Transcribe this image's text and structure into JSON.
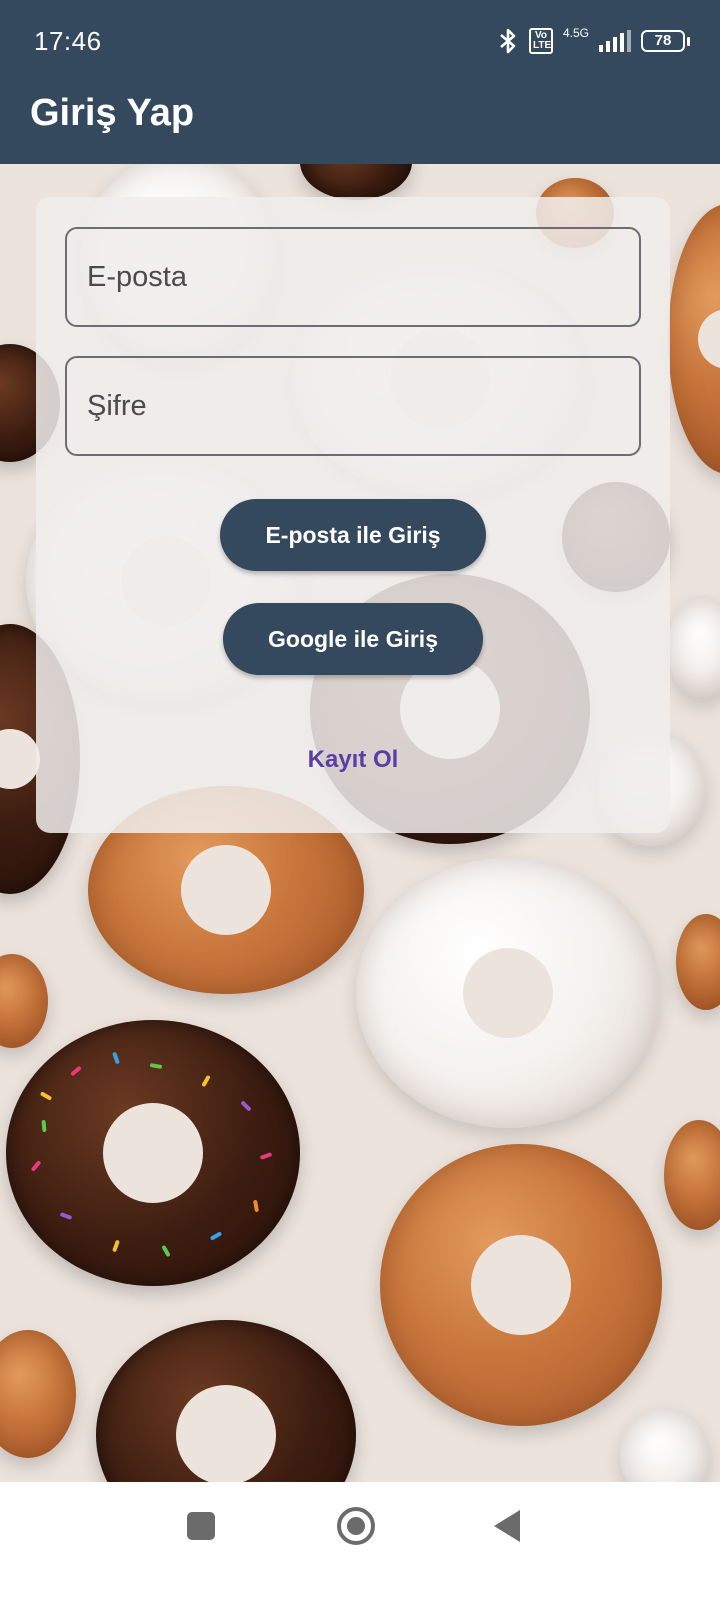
{
  "status_bar": {
    "time": "17:46",
    "network_label": "4.5G",
    "volte_label": "Vo LTE",
    "battery_level": "78",
    "icons": [
      "bluetooth-icon",
      "volte-icon",
      "signal-icon",
      "battery-icon"
    ]
  },
  "app_bar": {
    "title": "Giriş Yap"
  },
  "form": {
    "email_placeholder": "E-posta",
    "password_placeholder": "Şifre",
    "email_login_label": "E-posta ile Giriş",
    "google_login_label": "Google ile Giriş",
    "register_label": "Kayıt Ol"
  },
  "nav_bar": {
    "icons": [
      "recent-apps-icon",
      "home-icon",
      "back-icon"
    ]
  },
  "colors": {
    "primary": "#34495e",
    "link": "#5a3ea6",
    "card_background": "#f0eeec"
  }
}
